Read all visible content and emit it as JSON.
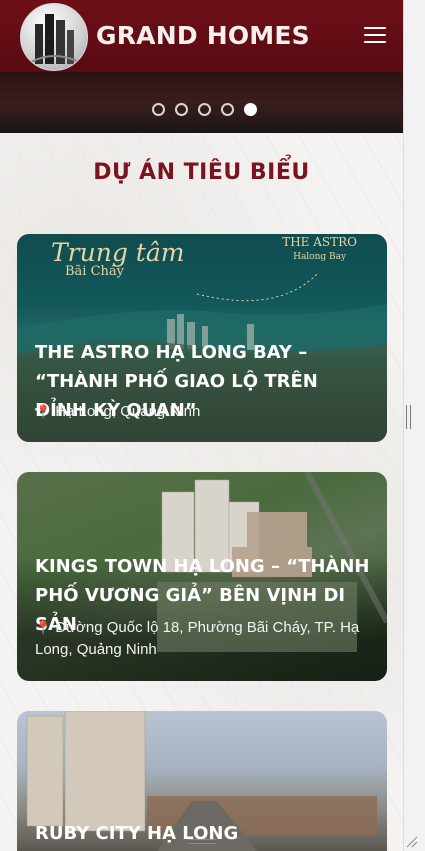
{
  "header": {
    "brand": "GRAND HOMES",
    "menu_icon": "hamburger-menu-icon",
    "logo_icon": "building-logo-icon"
  },
  "slider": {
    "dot_count": 5,
    "active_index": 4
  },
  "section": {
    "title": "DỰ ÁN TIÊU BIỂU"
  },
  "projects": [
    {
      "title": "THE ASTRO HẠ LONG BAY – “THÀNH PHỐ GIAO LỘ TRÊN ĐỈNH KỲ QUAN”",
      "location": "Hạ Long, Quảng Ninh",
      "image_text_main": "Trung tâm",
      "image_text_sub": "Bãi Cháy",
      "image_logo_line1": "THE ASTRO",
      "image_logo_line2": "Halong Bay"
    },
    {
      "title": "KINGS TOWN HẠ LONG – “THÀNH PHỐ VƯƠNG GIẢ” BÊN VỊNH DI SẢN",
      "location": "Đường Quốc lộ 18, Phường Bãi Cháy, TP. Hạ Long, Quảng Ninh"
    },
    {
      "title": "RUBY CITY HẠ LONG"
    }
  ],
  "colors": {
    "brand": "#6e0f17",
    "section_title": "#7a1520",
    "pin": "#e23a3a"
  }
}
